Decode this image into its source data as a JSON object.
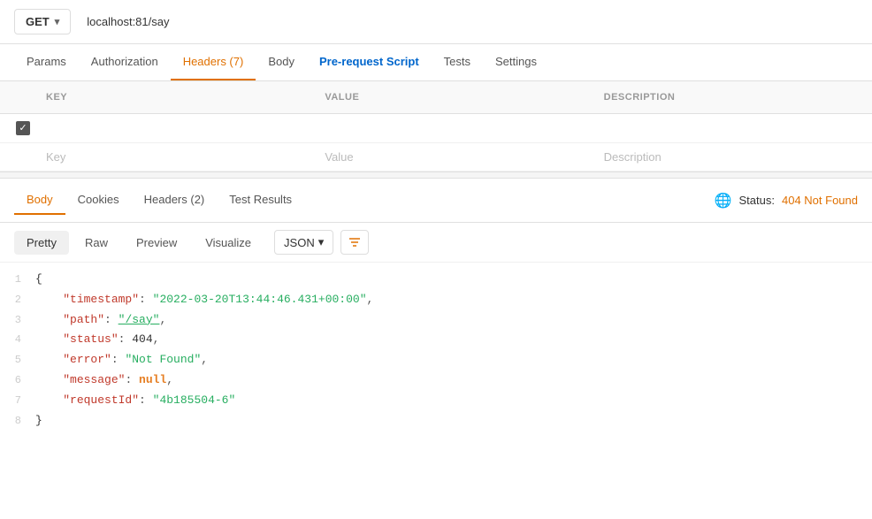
{
  "urlBar": {
    "method": "GET",
    "url": "localhost:81/say",
    "chevron": "▾"
  },
  "requestTabs": [
    {
      "id": "params",
      "label": "Params",
      "active": false,
      "style": "normal"
    },
    {
      "id": "authorization",
      "label": "Authorization",
      "active": false,
      "style": "normal"
    },
    {
      "id": "headers",
      "label": "Headers (7)",
      "active": true,
      "style": "active"
    },
    {
      "id": "body",
      "label": "Body",
      "active": false,
      "style": "normal"
    },
    {
      "id": "prerequest",
      "label": "Pre-request Script",
      "active": false,
      "style": "blue"
    },
    {
      "id": "tests",
      "label": "Tests",
      "active": false,
      "style": "normal"
    },
    {
      "id": "settings",
      "label": "Settings",
      "active": false,
      "style": "normal"
    }
  ],
  "headersTable": {
    "columns": [
      "",
      "KEY",
      "VALUE",
      "DESCRIPTION"
    ],
    "rows": [
      {
        "checked": true,
        "key": "",
        "value": "",
        "description": ""
      },
      {
        "checked": false,
        "key": "Key",
        "value": "Value",
        "description": "Description"
      }
    ]
  },
  "responseTabs": [
    {
      "id": "body",
      "label": "Body",
      "active": true
    },
    {
      "id": "cookies",
      "label": "Cookies",
      "active": false
    },
    {
      "id": "headers",
      "label": "Headers (2)",
      "active": false
    },
    {
      "id": "testresults",
      "label": "Test Results",
      "active": false
    }
  ],
  "status": {
    "globeIcon": "🌐",
    "label": "Status:",
    "value": "404 Not Found"
  },
  "formatToolbar": {
    "pretty": "Pretty",
    "raw": "Raw",
    "preview": "Preview",
    "visualize": "Visualize",
    "jsonLabel": "JSON",
    "chevron": "▾",
    "filterIcon": "≡"
  },
  "codeLines": [
    {
      "num": "1",
      "content": "{",
      "type": "brace"
    },
    {
      "num": "2",
      "content": "    \"timestamp\": \"2022-03-20T13:44:46.431+00:00\",",
      "type": "keyval-str"
    },
    {
      "num": "3",
      "content": "    \"path\": \"/say\",",
      "type": "keyval-link"
    },
    {
      "num": "4",
      "content": "    \"status\": 404,",
      "type": "keyval-num"
    },
    {
      "num": "5",
      "content": "    \"error\": \"Not Found\",",
      "type": "keyval-str2"
    },
    {
      "num": "6",
      "content": "    \"message\": null,",
      "type": "keyval-null"
    },
    {
      "num": "7",
      "content": "    \"requestId\": \"4b185504-6\"",
      "type": "keyval-str3"
    },
    {
      "num": "8",
      "content": "}",
      "type": "brace"
    }
  ]
}
